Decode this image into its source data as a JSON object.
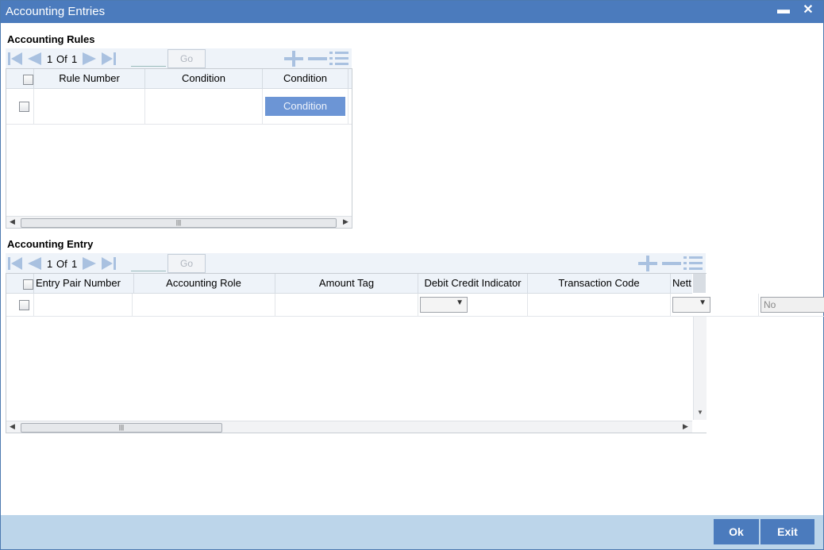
{
  "window": {
    "title": "Accounting Entries",
    "minimize_icon": "▬",
    "close_icon": "✕"
  },
  "rules": {
    "title": "Accounting Rules",
    "pager": {
      "current": "1",
      "of_label": "Of",
      "total": "1",
      "go_label": "Go"
    },
    "columns": [
      "Rule Number",
      "Condition",
      "Condition"
    ],
    "row_button": "Condition"
  },
  "entry": {
    "title": "Accounting Entry",
    "pager": {
      "current": "1",
      "of_label": "Of",
      "total": "1",
      "go_label": "Go"
    },
    "columns": [
      "Entry Pair Number",
      "Accounting Role",
      "Amount Tag",
      "Debit Credit Indicator",
      "Transaction Code",
      "Nett"
    ],
    "netting_value": "No"
  },
  "footer": {
    "ok_label": "Ok",
    "exit_label": "Exit"
  },
  "colors": {
    "titlebar": "#4b7bbd",
    "footer": "#bcd5ea",
    "accent": "#6c95d5"
  }
}
